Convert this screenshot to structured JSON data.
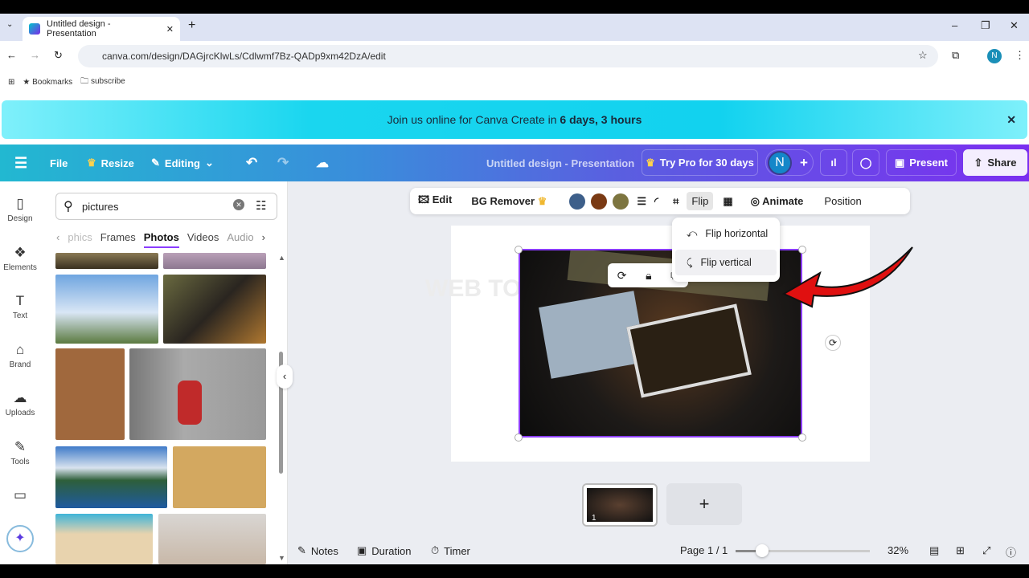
{
  "browser": {
    "tab_title": "Untitled design - Presentation",
    "url": "canva.com/design/DAGjrcKlwLs/Cdlwmf7Bz-QADp9xm42DzA/edit",
    "profile_initial": "N",
    "bookmarks": [
      "Bookmarks",
      "subscribe"
    ]
  },
  "banner": {
    "text": "Join us online for Canva Create in ",
    "highlight": "6 days, 3 hours"
  },
  "header": {
    "file": "File",
    "resize": "Resize",
    "editing": "Editing",
    "title": "Untitled design - Presentation",
    "try_pro": "Try Pro for 30 days",
    "avatar": "N",
    "present": "Present",
    "share": "Share"
  },
  "rail": [
    {
      "label": "Design",
      "icon": "▯"
    },
    {
      "label": "Elements",
      "icon": "❖"
    },
    {
      "label": "Text",
      "icon": "T"
    },
    {
      "label": "Brand",
      "icon": "⌂"
    },
    {
      "label": "Uploads",
      "icon": "☁"
    },
    {
      "label": "Tools",
      "icon": "✎"
    },
    {
      "label": "",
      "icon": "▭"
    }
  ],
  "panel": {
    "search_value": "pictures",
    "tabs": [
      "phics",
      "Frames",
      "Photos",
      "Videos",
      "Audio"
    ],
    "active_tab": "Photos"
  },
  "toolbar": {
    "edit": "Edit",
    "bg_remover": "BG Remover",
    "colors": [
      "#3d5f8a",
      "#7a3a14",
      "#7d7540"
    ],
    "flip": "Flip",
    "animate": "Animate",
    "position": "Position"
  },
  "flip_menu": {
    "horizontal": "Flip horizontal",
    "vertical": "Flip vertical"
  },
  "canvas": {
    "watermark": "WEB TO"
  },
  "thumbnail": {
    "page_number": "1"
  },
  "footer": {
    "notes": "Notes",
    "duration": "Duration",
    "timer": "Timer",
    "page": "Page 1 / 1",
    "zoom": "32%",
    "zoom_slider_percent": 20
  }
}
